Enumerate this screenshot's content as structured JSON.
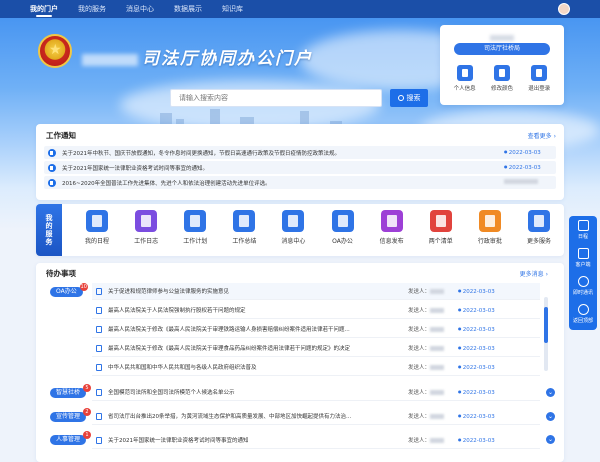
{
  "nav": {
    "items": [
      {
        "label": "我的门户",
        "active": true
      },
      {
        "label": "我的服务",
        "active": false
      },
      {
        "label": "消息中心",
        "active": false
      },
      {
        "label": "数据展示",
        "active": false
      },
      {
        "label": "知识库",
        "active": false
      }
    ]
  },
  "header": {
    "title": "司法厅协同办公门户"
  },
  "search": {
    "placeholder": "请输入搜索内容",
    "button_label": "搜索"
  },
  "user_card": {
    "dept": "司法厅社桥局",
    "actions": [
      {
        "label": "个人信息",
        "icon": "id-card-icon"
      },
      {
        "label": "修改颜色",
        "icon": "shirt-icon"
      },
      {
        "label": "退出登录",
        "icon": "logout-icon"
      }
    ]
  },
  "notices": {
    "title": "工作通知",
    "more": "查看更多",
    "items": [
      {
        "text": "关于2021年中秋节、国庆节放假通知，冬令作息时间更换通知，节假日高速通行政策及节假日疫情防控政策法规。",
        "date": "2022-03-03",
        "date_hidden": false
      },
      {
        "text": "关于2021年国家统一法律职业资格考试时间等事宜的通知。",
        "date": "2022-03-03",
        "date_hidden": false
      },
      {
        "text": "2016~2020年全国普法工作先进集体、先进个人和依法治理创建活动先进单位评选。",
        "date": "",
        "date_hidden": true
      }
    ]
  },
  "services": {
    "tag": "我的服务",
    "items": [
      {
        "label": "我的日程",
        "color": "#2f74e6",
        "icon": "calendar-icon"
      },
      {
        "label": "工作日志",
        "color": "#7b4de0",
        "icon": "log-icon"
      },
      {
        "label": "工作计划",
        "color": "#2f74e6",
        "icon": "plan-icon"
      },
      {
        "label": "工作总结",
        "color": "#2f74e6",
        "icon": "summary-icon"
      },
      {
        "label": "消息中心",
        "color": "#2f74e6",
        "icon": "message-icon"
      },
      {
        "label": "OA办公",
        "color": "#2f74e6",
        "icon": "oa-icon"
      },
      {
        "label": "信息发布",
        "color": "#9d3fd6",
        "icon": "publish-icon"
      },
      {
        "label": "两个清单",
        "color": "#e1433d",
        "icon": "list-icon"
      },
      {
        "label": "行政审批",
        "color": "#f08a24",
        "icon": "approval-icon"
      },
      {
        "label": "更多服务",
        "color": "#2f74e6",
        "icon": "more-icon"
      }
    ]
  },
  "todo": {
    "title": "待办事项",
    "more": "更多消息",
    "sender_label": "发送人：",
    "categories": [
      {
        "label": "OA办公",
        "count": "10"
      },
      {
        "label": "智慧社桥",
        "count": "5"
      },
      {
        "label": "宣传管理",
        "count": "2"
      },
      {
        "label": "人事管理",
        "count": "1"
      }
    ],
    "oa_items": [
      {
        "text": "关于促进和规范律师参与公益法律服务的实施意见",
        "date": "2022-03-03"
      },
      {
        "text": "最高人民法院关于人民法院强制执行股权若干问题的规定",
        "date": "2022-03-03"
      },
      {
        "text": "最高人民法院关于修改《最高人民法院关于审理铁路运输人身损害赔偿纠纷案件适用法律若干问题...",
        "date": "2022-03-03"
      },
      {
        "text": "最高人民法院关于修改《最高人民法院关于审理食品药品纠纷案件适用法律若干问题的规定》的决定",
        "date": "2022-03-03"
      },
      {
        "text": "中华人民共和国和中华人民共和国与各级人民政府组织法普及",
        "date": "2022-03-03"
      }
    ],
    "other_items": [
      {
        "text": "全国模范司法所和全国司法所模范个人候选名单公示",
        "date": "2022-03-03"
      },
      {
        "text": "省司法厅出台推出20条举措，为黄河流域生态保护和高质量发展、中部地区加快崛起提供有力法治...",
        "date": "2022-03-03"
      },
      {
        "text": "关于2021年国家统一法律职业资格考试时间等事宜的通知",
        "date": "2022-03-03"
      }
    ]
  },
  "float_bar": {
    "items": [
      {
        "label": "日程",
        "icon": "calendar-icon"
      },
      {
        "label": "客户端",
        "icon": "client-icon"
      },
      {
        "label": "即时通讯",
        "icon": "chat-icon"
      },
      {
        "label": "返回顶部",
        "icon": "top-icon"
      }
    ]
  }
}
